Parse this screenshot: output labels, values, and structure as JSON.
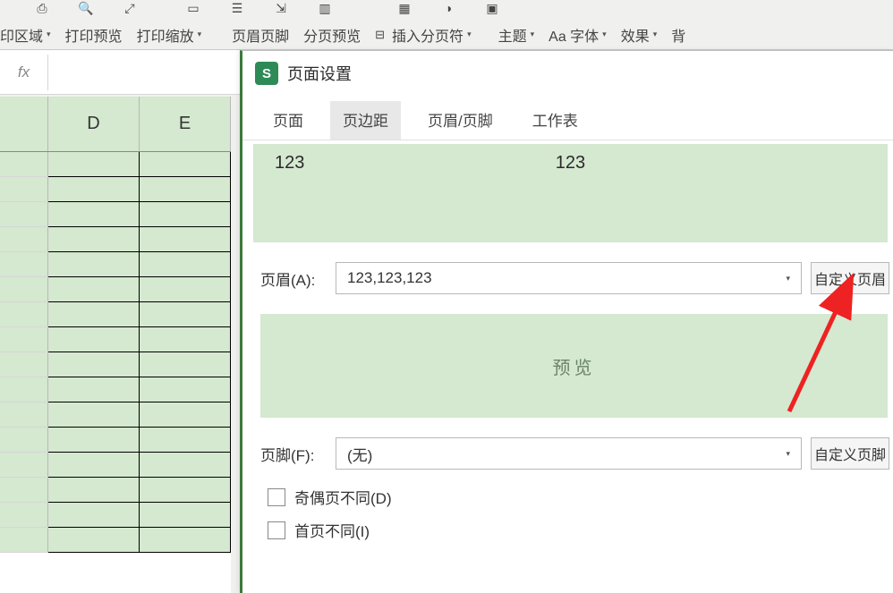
{
  "ribbon_top_icons": [
    "print-area-icon",
    "preview-icon",
    "zoom-icon",
    "header-footer-icon",
    "print-title-icon",
    "page-break-icon",
    "show-paging-icon",
    "color-icon",
    "picture-icon",
    "effects-icon"
  ],
  "ribbon_second": {
    "print_area": "印区域",
    "print_preview": "打印预览",
    "print_zoom": "打印缩放",
    "header_footer": "页眉页脚",
    "page_break_preview": "分页预览",
    "insert_page_break": "插入分页符",
    "theme": "主题",
    "font": "Aa 字体",
    "effects": "效果",
    "bg": "背"
  },
  "fx_label": "fx",
  "columns": [
    "D",
    "E"
  ],
  "dialog": {
    "logo_letter": "S",
    "title": "页面设置",
    "tabs": {
      "page": "页面",
      "margin": "页边距",
      "header_footer": "页眉/页脚",
      "worksheet": "工作表"
    },
    "header_preview": {
      "left": "123",
      "center": "123",
      "right": ""
    },
    "header_label": "页眉(A):",
    "header_value": "123,123,123",
    "custom_header_btn": "自定义页眉",
    "footer_preview_text": "预览",
    "footer_label": "页脚(F):",
    "footer_value": "(无)",
    "custom_footer_btn": "自定义页脚",
    "chk_odd_even": "奇偶页不同(D)",
    "chk_first_page": "首页不同(I)"
  }
}
